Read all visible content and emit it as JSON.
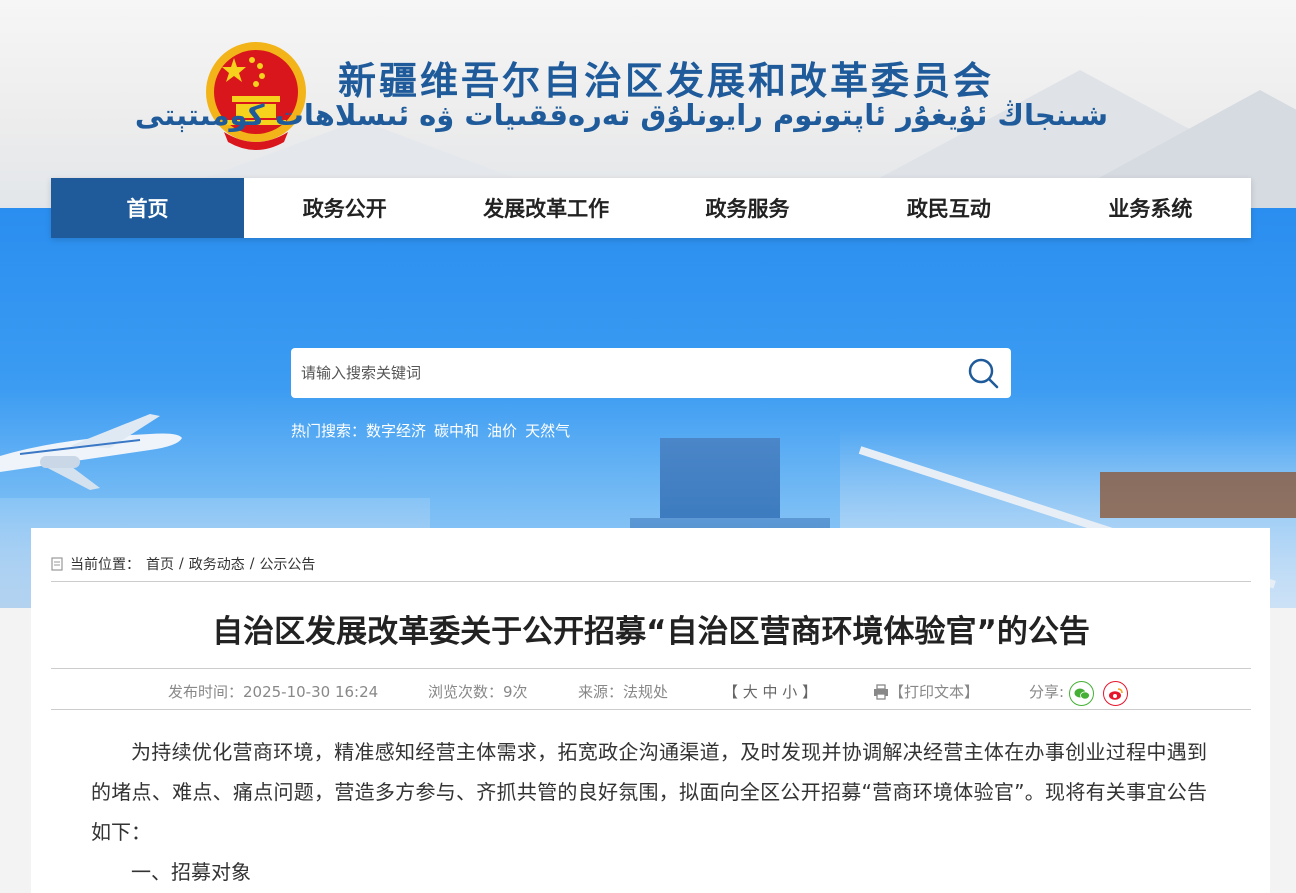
{
  "header": {
    "title_cn": "新疆维吾尔自治区发展和改革委员会",
    "title_ug": "شىنجاڭ ئۇيغۇر ئاپتونوم رايونلۇق تەرەققىيات ۋە ئىسلاھات كومىتېتى"
  },
  "nav": {
    "items": [
      "首页",
      "政务公开",
      "发展改革工作",
      "政务服务",
      "政民互动",
      "业务系统"
    ]
  },
  "search": {
    "placeholder": "请输入搜索关键词",
    "hot_label": "热门搜索：",
    "hot_keywords": [
      "数字经济",
      "碳中和",
      "油价",
      "天然气"
    ]
  },
  "breadcrumb": {
    "label": "当前位置：",
    "items": [
      "首页",
      "政务动态",
      "公示公告"
    ]
  },
  "article": {
    "title": "自治区发展改革委关于公开招募“自治区营商环境体验官”的公告",
    "publish": "发布时间：2025-10-30 16:24",
    "views": "浏览次数：9次",
    "source": "来源：法规处",
    "font_size": "【 大  中  小 】",
    "print": "【打印文本】",
    "share_label": "分享:",
    "paragraphs": [
      "为持续优化营商环境，精准感知经营主体需求，拓宽政企沟通渠道，及时发现并协调解决经营主体在办事创业过程中遇到的堵点、难点、痛点问题，营造多方参与、齐抓共管的良好氛围，拟面向全区公开招募“营商环境体验官”。现将有关事宜公告如下：",
      "一、招募对象"
    ]
  },
  "colors": {
    "brand": "#1f5b9a",
    "banner_sky": "#2a8ef0",
    "wechat": "#45b035",
    "weibo": "#e6162d"
  },
  "icons": [
    "national-emblem-icon",
    "search-icon",
    "location-icon",
    "printer-icon",
    "wechat-icon",
    "weibo-icon"
  ]
}
